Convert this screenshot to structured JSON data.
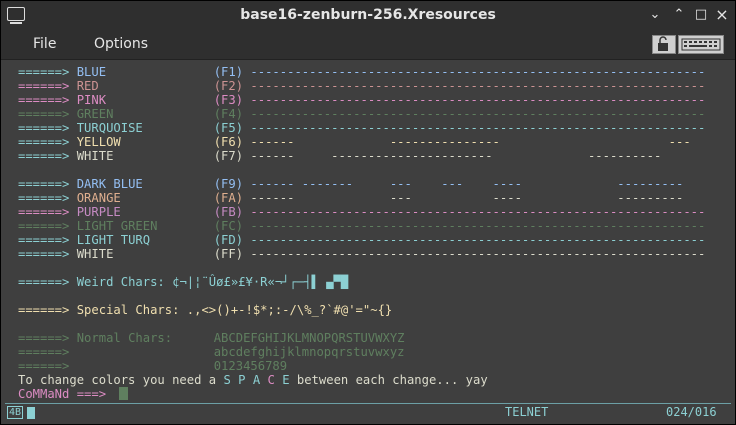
{
  "window": {
    "title": "base16-zenburn-256.Xresources",
    "minimize": "⌄",
    "restore": "⌃",
    "maximize": "□",
    "close": "×"
  },
  "menubar": {
    "items": [
      "File",
      "Options"
    ]
  },
  "terminal": {
    "arrow": "======>",
    "colors": [
      {
        "name": "BLUE",
        "key": "(F1)",
        "dashes": "--------------------------------------------------------------"
      },
      {
        "name": "RED",
        "key": "(F2)",
        "dashes": "--------------------------------------------------------------"
      },
      {
        "name": "PINK",
        "key": "(F3)",
        "dashes": "--------------------------------------------------------------"
      },
      {
        "name": "GREEN",
        "key": "(F4)",
        "dashes": "--------------------------------------------------------------"
      },
      {
        "name": "TURQUOISE",
        "key": "(F5)",
        "dashes": "--------------------------------------------------------------"
      },
      {
        "name": "YELLOW",
        "key": "(F6)",
        "dashes": "------             ---------------                       ---"
      },
      {
        "name": "WHITE",
        "key": "(F7)",
        "dashes": "------     ----------------------             ----------"
      },
      {
        "name": "",
        "key": "",
        "dashes": ""
      },
      {
        "name": "DARK BLUE",
        "key": "(F9)",
        "dashes": "------ -------     ---    ---    ----             ---------"
      },
      {
        "name": "ORANGE",
        "key": "(FA)",
        "dashes": "------             ---           ----             ---------"
      },
      {
        "name": "PURPLE",
        "key": "(FB)",
        "dashes": "--------------------------------------------------------------"
      },
      {
        "name": "LIGHT GREEN",
        "key": "(FC)",
        "dashes": "--------------------------------------------------------------"
      },
      {
        "name": "LIGHT TURQ",
        "key": "(FD)",
        "dashes": "--------------------------------------------------------------"
      },
      {
        "name": "WHITE",
        "key": "(FF)",
        "dashes": "--------------------------------------------------------------"
      }
    ],
    "weird_label": "Weird Chars:",
    "weird_chars": "¢¬|¦¨Ûø£»£¥·R«¬┘┌─┤▌ ▄▀█",
    "special_label": "Special Chars:",
    "special_chars": ".,<>()+-!$*;:-/\\%_?`#@'=\"~{}",
    "normal_label": "Normal Chars:",
    "normal_upper": "ABCDEFGHIJKLMNOPQRSTUVWXYZ",
    "normal_lower": "abcdefghijklmnopqrstuvwxyz",
    "normal_digits": "0123456789",
    "change_prefix": "To change colors you need a ",
    "change_space": [
      "S",
      "P",
      "A",
      "C",
      "E"
    ],
    "change_suffix": " between each change... yay",
    "command_prompt": "CoMMaNd ===>"
  },
  "statusbar": {
    "left": "4B",
    "mode": "TELNET",
    "position": "024/016"
  },
  "colors": {
    "pink": "#dc8cc3",
    "teal": "#8cd0d3",
    "background": "#3f3f3f"
  }
}
